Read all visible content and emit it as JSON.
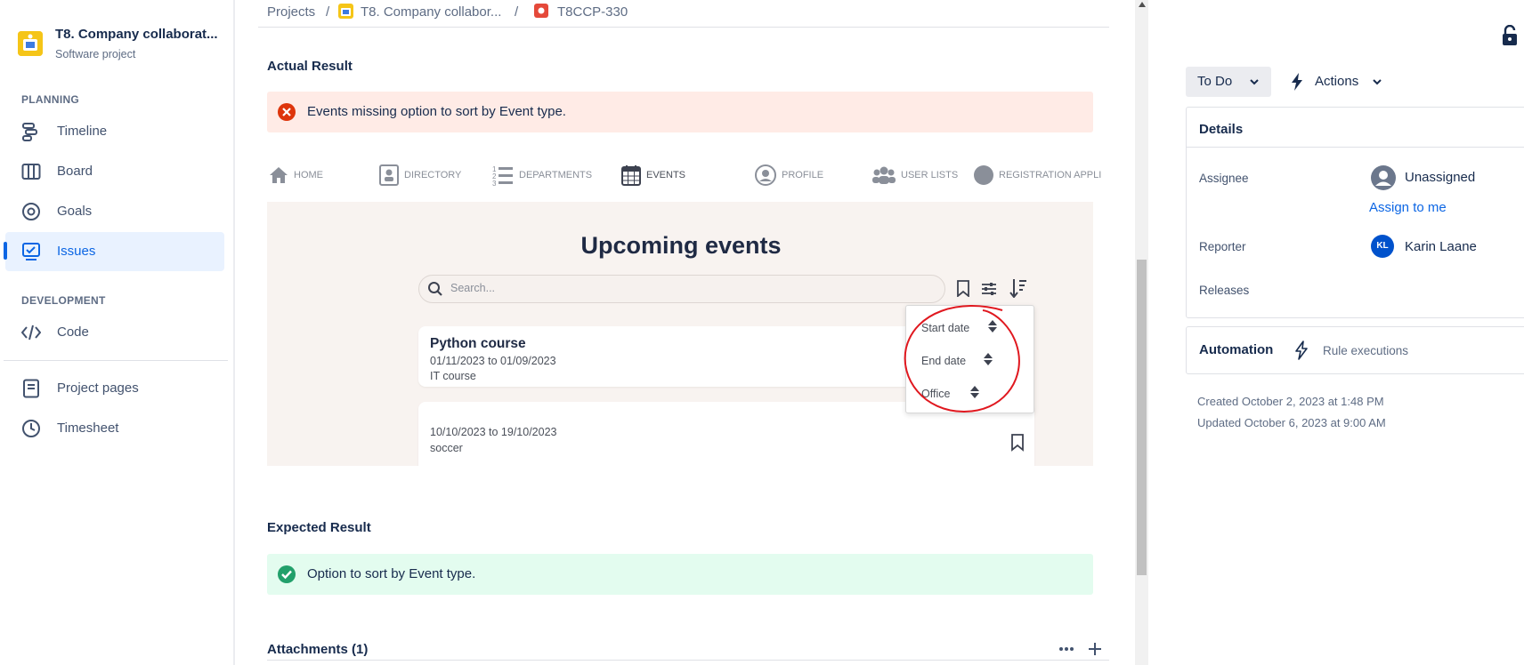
{
  "project": {
    "name": "T8. Company collaborat...",
    "type": "Software project"
  },
  "sidebar": {
    "planning_heading": "PLANNING",
    "development_heading": "DEVELOPMENT",
    "items": [
      {
        "label": "Timeline",
        "icon": "timeline-icon"
      },
      {
        "label": "Board",
        "icon": "board-icon"
      },
      {
        "label": "Goals",
        "icon": "goals-icon"
      },
      {
        "label": "Issues",
        "icon": "issues-icon",
        "active": true
      },
      {
        "label": "Code",
        "icon": "code-icon"
      },
      {
        "label": "Project pages",
        "icon": "pages-icon"
      },
      {
        "label": "Timesheet",
        "icon": "clock-icon"
      }
    ]
  },
  "breadcrumb": {
    "projects": "Projects",
    "sep": "/",
    "project": "T8. Company collabor...",
    "issue_key": "T8CCP-330"
  },
  "content": {
    "actual_result_title": "Actual Result",
    "actual_result_text": "Events missing option to sort by Event type.",
    "expected_result_title": "Expected Result",
    "expected_result_text": "Option to sort by Event type.",
    "attachments_title": "Attachments (1)"
  },
  "screenshot": {
    "nav": [
      "HOME",
      "DIRECTORY",
      "DEPARTMENTS",
      "EVENTS",
      "PROFILE",
      "USER LISTS",
      "REGISTRATION APPLI"
    ],
    "title": "Upcoming events",
    "search_placeholder": "Search...",
    "events": [
      {
        "name": "Python course",
        "dates": "01/11/2023 to 01/09/2023",
        "category": "IT course"
      },
      {
        "name": "",
        "dates": "10/10/2023 to 19/10/2023",
        "category": "soccer"
      }
    ],
    "sort_options": [
      "Start date",
      "End date",
      "Office"
    ]
  },
  "right_panel": {
    "status": "To Do",
    "actions": "Actions",
    "details_title": "Details",
    "assignee_label": "Assignee",
    "assignee_value": "Unassigned",
    "assign_to_me": "Assign to me",
    "reporter_label": "Reporter",
    "reporter_initials": "KL",
    "reporter_value": "Karin Laane",
    "releases_label": "Releases",
    "automation_title": "Automation",
    "rule_executions": "Rule executions",
    "created": "Created October 2, 2023 at 1:48 PM",
    "updated": "Updated October 6, 2023 at 9:00 AM"
  },
  "colors": {
    "accent": "#0c66e4",
    "error_bg": "#ffebe6",
    "error_icon": "#de350b",
    "success_bg": "#e3fcef",
    "success_icon": "#22a06b",
    "annotation": "#e0181f",
    "avatar": "#0052cc"
  }
}
